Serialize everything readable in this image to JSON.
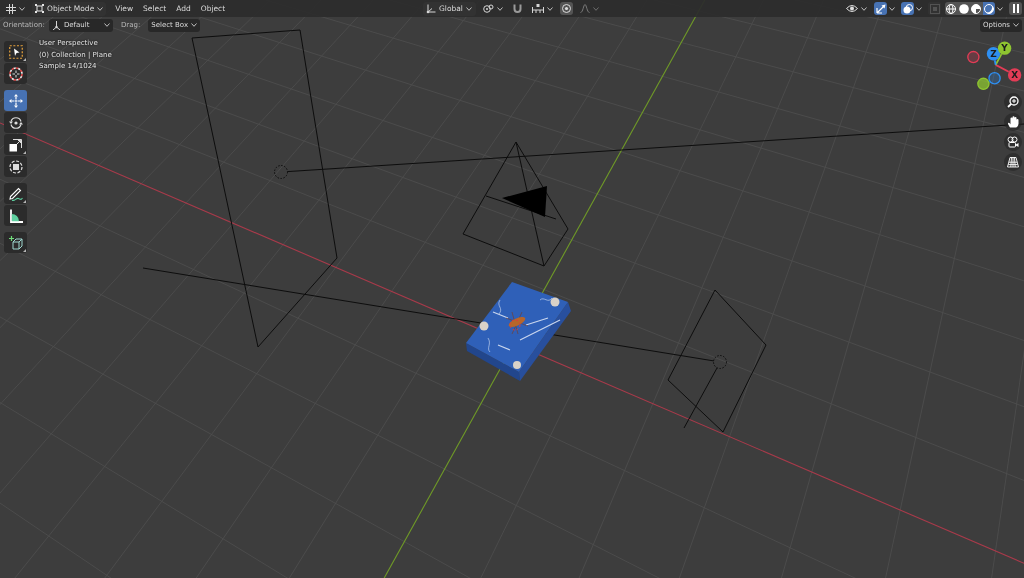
{
  "header": {
    "mode": "Object Mode",
    "menus": [
      "View",
      "Select",
      "Add",
      "Object"
    ],
    "transform_orientation": "Global",
    "proportional_editing": {
      "on": false
    },
    "gizmos": {
      "on": true
    },
    "overlays": {
      "on": true
    },
    "xray": {
      "on": false
    },
    "shading_modes": [
      {
        "selected": false
      },
      {
        "selected": false
      },
      {
        "selected": false
      },
      {
        "selected": true
      }
    ]
  },
  "tool_settings": {
    "orientation": {
      "label": "Orientation:",
      "value": "Default"
    },
    "drag": {
      "label": "Drag:",
      "value": "Select Box"
    },
    "options": "Options"
  },
  "toolbar": {
    "groups": [
      {
        "tools": [
          {
            "selected": false,
            "more_tools": true
          },
          {
            "selected": false,
            "more_tools": false
          }
        ]
      },
      {
        "tools": [
          {
            "selected": true,
            "more_tools": false
          },
          {
            "selected": false,
            "more_tools": false
          },
          {
            "selected": false,
            "more_tools": true
          },
          {
            "selected": false,
            "more_tools": false
          }
        ]
      },
      {
        "tools": [
          {
            "selected": false,
            "more_tools": true
          },
          {
            "selected": false,
            "more_tools": false
          }
        ]
      },
      {
        "tools": [
          {
            "selected": false,
            "more_tools": true
          }
        ]
      }
    ]
  },
  "viewport_info": [
    "User Perspective",
    "(0) Collection | Plane",
    "Sample 14/1024"
  ],
  "navigation_gizmo": {
    "axes": [
      {
        "label": "X",
        "color": "#e33c56"
      },
      {
        "label": "Y",
        "color": "#8ec530"
      },
      {
        "label": "Z",
        "color": "#2e8ff2"
      }
    ]
  }
}
